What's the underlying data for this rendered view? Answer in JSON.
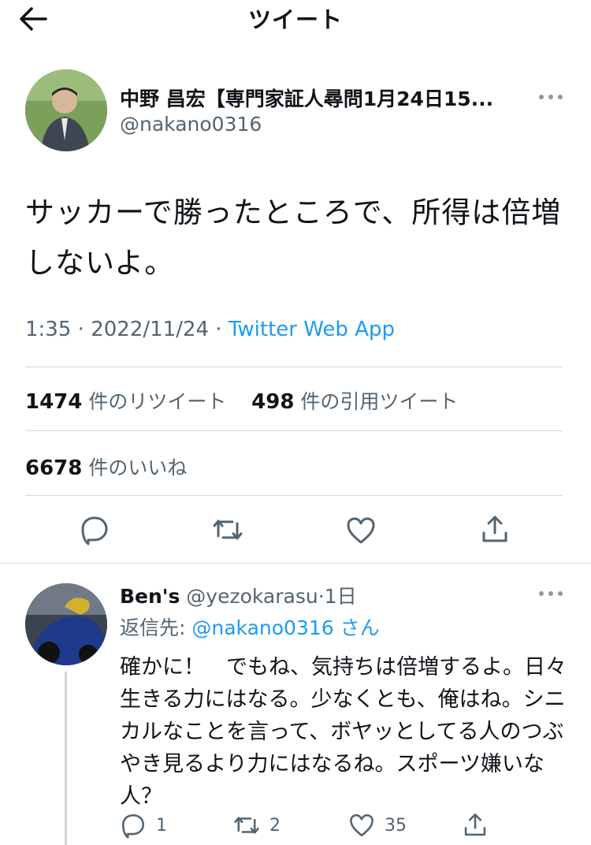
{
  "header": {
    "title": "ツイート",
    "back_icon": "arrow-left-icon"
  },
  "tweet": {
    "author_name": "中野 昌宏【専門家証人尋問1月24日15...",
    "author_handle": "@nakano0316",
    "text": "サッカーで勝ったところで、所得は倍増しないよ。",
    "time": "1:35",
    "date": "2022/11/24",
    "source": "Twitter Web App",
    "retweets_count": "1474",
    "retweets_label": "件のリツイート",
    "quotes_count": "498",
    "quotes_label": "件の引用ツイート",
    "likes_count": "6678",
    "likes_label": "件のいいね",
    "actions": [
      "reply-icon",
      "retweet-icon",
      "like-icon",
      "share-icon"
    ]
  },
  "reply": {
    "author_name": "Ben's",
    "author_handle": "@yezokarasu",
    "age": "1日",
    "reply_to_prefix": "返信先:",
    "reply_to_handle": "@nakano0316",
    "reply_to_suffix": "さん",
    "text": "確かに！　でもね、気持ちは倍増するよ。日々生きる力にはなる。少なくとも、俺はね。シニカルなことを言って、ボヤッとしてる人のつぶやき見るより力にはなるね。スポーツ嫌いな人？",
    "reply_count": "1",
    "retweet_count": "2",
    "like_count": "35"
  }
}
